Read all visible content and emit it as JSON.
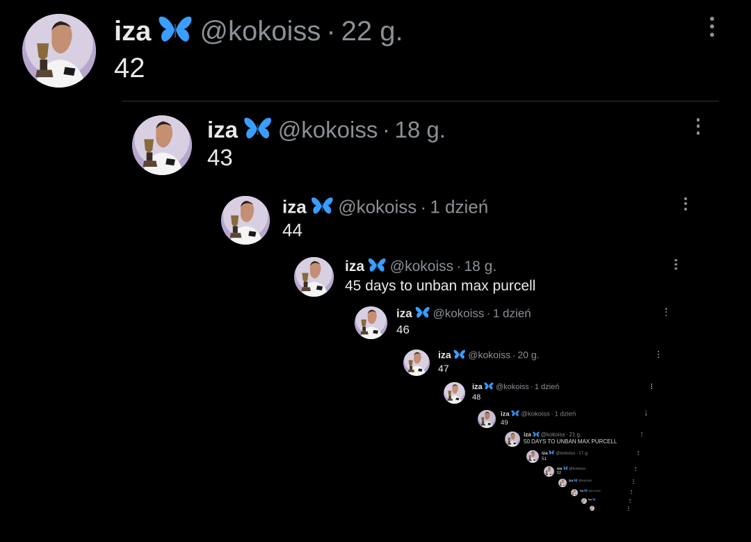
{
  "tweets": [
    {
      "name": "iza",
      "handle": "@kokoiss",
      "sep": "·",
      "time": "22 g.",
      "text": "42"
    },
    {
      "name": "iza",
      "handle": "@kokoiss",
      "sep": "·",
      "time": "18 g.",
      "text": "43"
    },
    {
      "name": "iza",
      "handle": "@kokoiss",
      "sep": "·",
      "time": "1 dzień",
      "text": "44"
    },
    {
      "name": "iza",
      "handle": "@kokoiss",
      "sep": "·",
      "time": "18 g.",
      "text": "45 days to unban max purcell"
    },
    {
      "name": "iza",
      "handle": "@kokoiss",
      "sep": "·",
      "time": "1 dzień",
      "text": "46"
    },
    {
      "name": "iza",
      "handle": "@kokoiss",
      "sep": "·",
      "time": "20 g.",
      "text": "47"
    },
    {
      "name": "iza",
      "handle": "@kokoiss",
      "sep": "·",
      "time": "1 dzień",
      "text": "48"
    },
    {
      "name": "iza",
      "handle": "@kokoiss",
      "sep": "·",
      "time": "1 dzień",
      "text": "49"
    },
    {
      "name": "iza",
      "handle": "@kokoiss",
      "sep": "·",
      "time": "21 g.",
      "text": "50 DAYS TO UNBAN MAX PURCELL"
    },
    {
      "name": "iza",
      "handle": "@kokoiss",
      "sep": "·",
      "time": "17 g.",
      "text": "51"
    },
    {
      "name": "iza",
      "handle": "@kokoiss",
      "sep": "·",
      "time": "",
      "text": "52"
    },
    {
      "name": "iza",
      "handle": "@kokoiss",
      "sep": "",
      "time": "",
      "text": ""
    },
    {
      "name": "iza",
      "handle": "@kokoiss",
      "sep": "",
      "time": "",
      "text": ""
    },
    {
      "name": "iza",
      "handle": "",
      "sep": "",
      "time": "",
      "text": ""
    },
    {
      "name": "",
      "handle": "",
      "sep": "",
      "time": "",
      "text": ""
    }
  ],
  "colors": {
    "background": "#000000",
    "text": "#e7e9ea",
    "muted": "#8b9096",
    "butterfly": "#3b9dff"
  },
  "icons": {
    "verified": "butterfly-icon",
    "menu": "more-options-icon"
  }
}
